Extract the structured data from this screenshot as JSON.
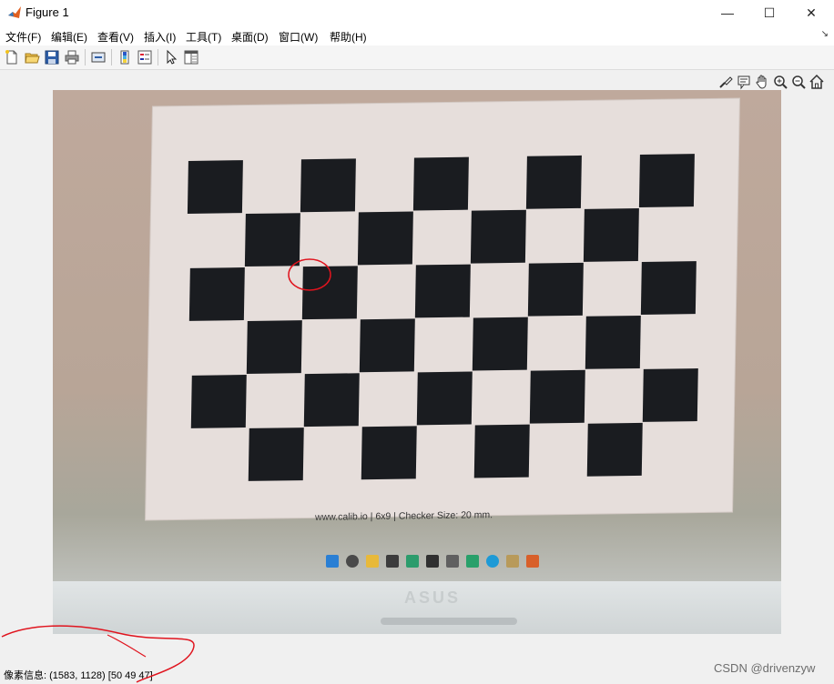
{
  "window": {
    "title": "Figure 1",
    "controls": {
      "minimize": "—",
      "maximize": "☐",
      "close": "✕"
    }
  },
  "menubar": {
    "items": [
      "文件(F)",
      "编辑(E)",
      "查看(V)",
      "插入(I)",
      "工具(T)",
      "桌面(D)",
      "窗口(W)",
      "帮助(H)"
    ],
    "dock_glyph": "↘"
  },
  "toolbar": {
    "buttons": [
      "new-figure-icon",
      "open-file-icon",
      "save-icon",
      "print-icon",
      "link-plot-icon",
      "insert-colorbar-icon",
      "insert-legend-icon",
      "pointer-icon",
      "property-inspector-icon"
    ]
  },
  "axes_toolbar": {
    "buttons": [
      "brush-icon",
      "data-tips-icon",
      "pan-icon",
      "zoom-in-icon",
      "zoom-out-icon",
      "home-icon"
    ]
  },
  "image": {
    "caption": "www.calib.io | 6x9 | Checker Size: 20 mm.",
    "laptop_brand": "ASUS"
  },
  "status": {
    "label": "像素信息:",
    "coords": "(1583, 1128)",
    "rgb": "[50 49 47]"
  },
  "watermark": "CSDN @drivenzyw",
  "colors": {
    "annotation": "#e0141e",
    "checker_dark": "#1a1c20",
    "checker_light": "#e6dedb"
  }
}
